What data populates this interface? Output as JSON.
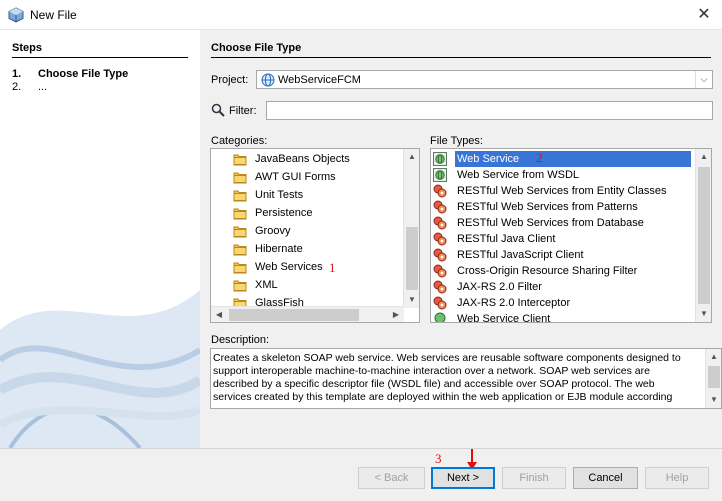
{
  "window": {
    "title": "New File",
    "close_glyph": "✕"
  },
  "steps": {
    "heading": "Steps",
    "items": [
      {
        "num": "1.",
        "label": "Choose File Type",
        "active": true
      },
      {
        "num": "2.",
        "label": "...",
        "active": false
      }
    ]
  },
  "main": {
    "heading": "Choose File Type",
    "project_label": "Project:",
    "project_value": "WebServiceFCM",
    "filter_label": "Filter:",
    "filter_value": "",
    "categories_label": "Categories:",
    "file_types_label": "File Types:",
    "description_label": "Description:"
  },
  "categories": [
    "JavaBeans Objects",
    "AWT GUI Forms",
    "Unit Tests",
    "Persistence",
    "Groovy",
    "Hibernate",
    "Web Services",
    "XML",
    "GlassFish"
  ],
  "file_types": [
    {
      "label": "Web Service",
      "icon": "web-service-icon",
      "selected": true
    },
    {
      "label": "Web Service from WSDL",
      "icon": "web-service-icon"
    },
    {
      "label": "RESTful Web Services from Entity Classes",
      "icon": "rest-icon"
    },
    {
      "label": "RESTful Web Services from Patterns",
      "icon": "rest-icon"
    },
    {
      "label": "RESTful Web Services from Database",
      "icon": "rest-icon"
    },
    {
      "label": "RESTful Java Client",
      "icon": "rest-icon"
    },
    {
      "label": "RESTful JavaScript Client",
      "icon": "rest-icon"
    },
    {
      "label": "Cross-Origin Resource Sharing Filter",
      "icon": "rest-icon"
    },
    {
      "label": "JAX-RS 2.0 Filter",
      "icon": "rest-icon"
    },
    {
      "label": "JAX-RS 2.0 Interceptor",
      "icon": "rest-icon"
    },
    {
      "label": "Web Service Client",
      "icon": "ws-client-icon"
    }
  ],
  "description": "Creates a skeleton SOAP web service. Web services are reusable software components designed to support interoperable machine-to-machine interaction over a network. SOAP web services are described by a specific descriptor file (WSDL file) and accessible over SOAP protocol. The web services created by this template are deployed within the web application or EJB module according",
  "annotations": {
    "a1": "1",
    "a2": "2",
    "a3": "3"
  },
  "buttons": {
    "back": "< Back",
    "next": "Next >",
    "finish": "Finish",
    "cancel": "Cancel",
    "help": "Help"
  },
  "colors": {
    "selection": "#3875d7",
    "annotation": "#e01010",
    "focus_border": "#0078d7"
  }
}
